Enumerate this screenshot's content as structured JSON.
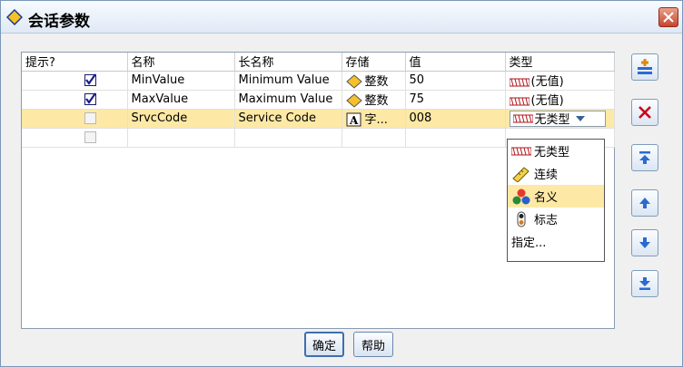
{
  "window": {
    "title": "会话参数"
  },
  "table": {
    "columns": [
      "提示?",
      "名称",
      "长名称",
      "存储",
      "值",
      "类型"
    ],
    "rows": [
      {
        "prompt": true,
        "name": "MinValue",
        "long_name": "Minimum Value",
        "storage": "整数",
        "value": "50",
        "type": "(无值)",
        "selected": false
      },
      {
        "prompt": true,
        "name": "MaxValue",
        "long_name": "Maximum Value",
        "storage": "整数",
        "value": "75",
        "type": "(无值)",
        "selected": false
      },
      {
        "prompt": false,
        "name": "SrvcCode",
        "long_name": "Service Code",
        "storage": "字...",
        "value": "008",
        "type": "无类型",
        "selected": true
      },
      {
        "prompt": false,
        "name": "",
        "long_name": "",
        "storage": "",
        "value": "",
        "type": "",
        "selected": false
      }
    ]
  },
  "type_dropdown": {
    "options": [
      "无类型",
      "连续",
      "名义",
      "标志",
      "指定..."
    ],
    "highlighted": "名义"
  },
  "buttons": {
    "ok": "确定",
    "help": "帮助"
  },
  "side_toolbar": [
    "add-row-icon",
    "delete-icon",
    "move-top-icon",
    "move-up-icon",
    "move-down-icon",
    "move-bottom-icon"
  ],
  "colors": {
    "selection": "#fde9a5",
    "delete_red": "#d0021b",
    "arrow_blue": "#2a6bd0"
  }
}
